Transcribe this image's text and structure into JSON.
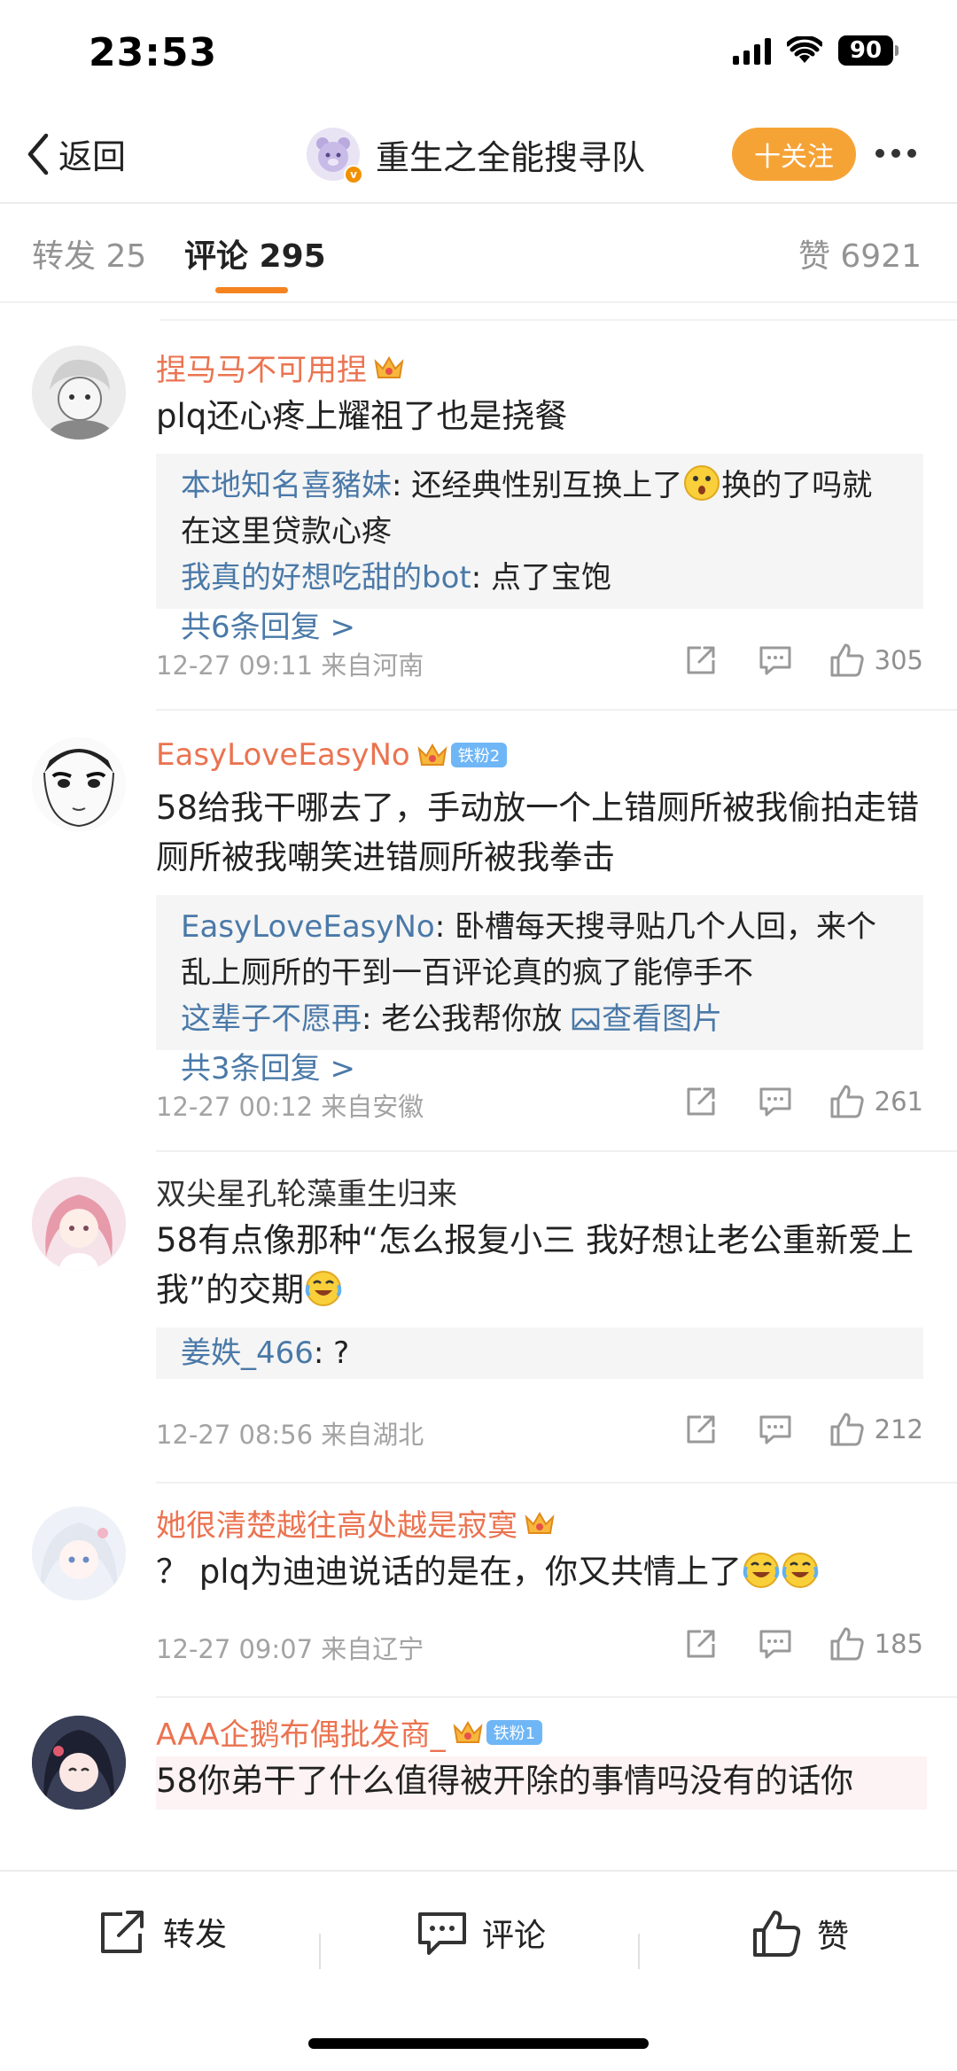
{
  "status_bar": {
    "time": "23:53",
    "battery": "90"
  },
  "nav": {
    "back_label": "返回",
    "title": "重生之全能搜寻队",
    "follow_label": "十关注"
  },
  "tabs": {
    "repost": "转发 25",
    "comment": "评论 295",
    "like": "赞 6921"
  },
  "comments": [
    {
      "username": "捏马马不可用捏",
      "text": "plq还心疼上耀祖了也是挠餐",
      "replies": [
        {
          "name": "本地知名喜豬妹",
          "text": ": 还经典性别互换上了",
          "text_after": "换的了吗就在这里贷款心疼"
        },
        {
          "name": "我真的好想吃甜的bot",
          "text": ": 点了宝饱"
        }
      ],
      "more": "共6条回复 >",
      "meta": "12-27 09:11  来自河南",
      "likes": "305"
    },
    {
      "username": "EasyLoveEasyNo",
      "badge": "铁粉2",
      "text": "58给我干哪去了，手动放一个上错厕所被我偷拍走错厕所被我嘲笑进错厕所被我拳击",
      "replies": [
        {
          "name": "EasyLoveEasyNo",
          "text": ": 卧槽每天搜寻贴几个人回，来个乱上厕所的干到一百评论真的疯了能停手不"
        },
        {
          "name": "这辈子不愿再",
          "text": ": 老公我帮你放 ",
          "link": "查看图片"
        }
      ],
      "more": "共3条回复 >",
      "meta": "12-27 00:12  来自安徽",
      "likes": "261"
    },
    {
      "username": "双尖星孔轮藻重生归来",
      "text": "58有点像那种“怎么报复小三 我好想让老公重新爱上我”的交期",
      "replies": [
        {
          "name": "姜妷_466",
          "text": ": ?"
        }
      ],
      "meta": "12-27 08:56  来自湖北",
      "likes": "212"
    },
    {
      "username": "她很清楚越往高处越是寂寞",
      "text": "？ plq为迪迪说话的是在，你又共情上了",
      "meta": "12-27 09:07  来自辽宁",
      "likes": "185"
    },
    {
      "username": "AAA企鹅布偶批发商_",
      "badge": "铁粉1",
      "text": "58你弟干了什么值得被开除的事情吗没有的话你"
    }
  ],
  "bottom_bar": {
    "repost": "转发",
    "comment": "评论",
    "like": "赞"
  },
  "colors": {
    "accent": "#f58320",
    "username": "#eb7350",
    "link": "#4a79a8",
    "follow": "#f6a336"
  },
  "icons": [
    "chevron-left-icon",
    "share-icon",
    "comment-icon",
    "thumbs-up-icon",
    "crown-icon",
    "image-icon"
  ]
}
